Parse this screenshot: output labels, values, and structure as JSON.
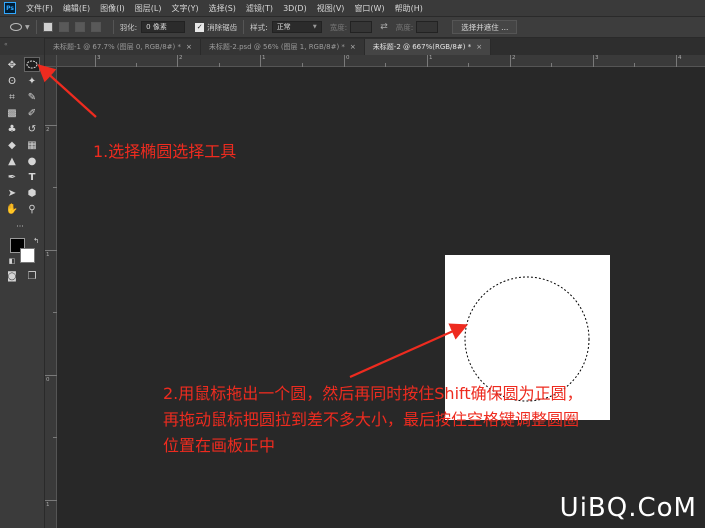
{
  "menu": {
    "items": [
      "文件(F)",
      "编辑(E)",
      "图像(I)",
      "图层(L)",
      "文字(Y)",
      "选择(S)",
      "滤镜(T)",
      "3D(D)",
      "视图(V)",
      "窗口(W)",
      "帮助(H)"
    ]
  },
  "options": {
    "feather_label": "羽化:",
    "feather_value": "0 像素",
    "antialias_label": "消除锯齿",
    "style_label": "样式:",
    "style_value": "正常",
    "width_label": "宽度:",
    "height_label": "高度:",
    "select_mask_button": "选择并遮住 ..."
  },
  "tabs": [
    {
      "label": "未标题-1 @ 67.7% (图层 0, RGB/8#) *",
      "close": "×"
    },
    {
      "label": "未标题-2.psd @ 56% (图层 1, RGB/8#) *",
      "close": "×"
    },
    {
      "label": "未标题-2 @ 667%(RGB/8#) *",
      "close": "×"
    }
  ],
  "toolbar": {
    "grip": "«",
    "more": "···"
  },
  "ruler": {
    "top_labels": [
      "3",
      "2",
      "1",
      "0",
      "1",
      "2",
      "3",
      "4"
    ],
    "left_labels": [
      "2",
      "1",
      "0",
      "1"
    ]
  },
  "annotations": {
    "step1": "1.选择椭圆选择工具",
    "step2_line1": "2.用鼠标拖出一个圆，然后再同时按住Shift确保圆为正圆，",
    "step2_line2": "再拖动鼠标把圆拉到差不多大小，最后按住空格键调整圆圈",
    "step2_line3": "位置在画板正中",
    "color": "#ee2b1f"
  },
  "watermark": "UiBQ.CoM"
}
